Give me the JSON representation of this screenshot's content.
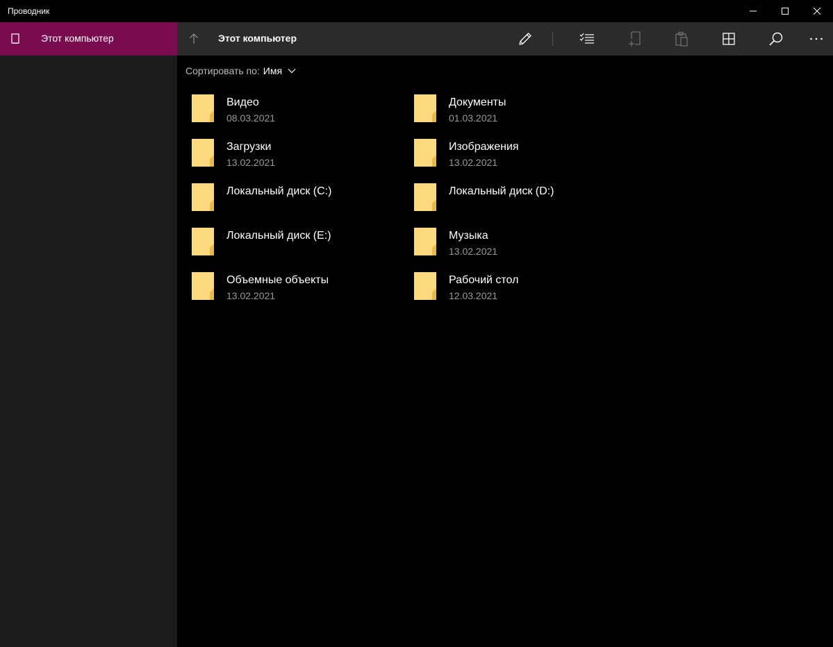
{
  "window": {
    "title": "Проводник",
    "buttons": {
      "minimize": "minimize-icon",
      "maximize": "maximize-icon",
      "close": "close-icon"
    }
  },
  "sidebar": {
    "items": [
      {
        "label": "Этот компьютер",
        "icon": "tablet-device-icon",
        "selected": true
      }
    ],
    "accent_color": "#7b0b4f"
  },
  "commandbar": {
    "up_icon": "arrow-up-icon",
    "path_title": "Этот компьютер",
    "actions": [
      {
        "icon": "pencil-icon",
        "enabled": true
      },
      {
        "icon": "select-list-icon",
        "enabled": true
      },
      {
        "icon": "new-folder-icon",
        "enabled": false
      },
      {
        "icon": "paste-icon",
        "enabled": false
      },
      {
        "icon": "grid-view-icon",
        "enabled": true
      },
      {
        "icon": "search-icon",
        "enabled": true
      },
      {
        "icon": "more-icon",
        "enabled": true
      }
    ]
  },
  "sort": {
    "label": "Сортировать по:",
    "value": "Имя"
  },
  "items": [
    {
      "name": "Видео",
      "date": "08.03.2021"
    },
    {
      "name": "Документы",
      "date": "01.03.2021"
    },
    {
      "name": "Загрузки",
      "date": "13.02.2021"
    },
    {
      "name": "Изображения",
      "date": "13.02.2021"
    },
    {
      "name": "Локальный диск (C:)",
      "date": ""
    },
    {
      "name": "Локальный диск (D:)",
      "date": ""
    },
    {
      "name": "Локальный диск (E:)",
      "date": ""
    },
    {
      "name": "Музыка",
      "date": "13.02.2021"
    },
    {
      "name": "Объемные объекты",
      "date": "13.02.2021"
    },
    {
      "name": "Рабочий стол",
      "date": "12.03.2021"
    }
  ],
  "colors": {
    "folder": "#fcdb7e",
    "folder_dark": "#e8b94a"
  }
}
